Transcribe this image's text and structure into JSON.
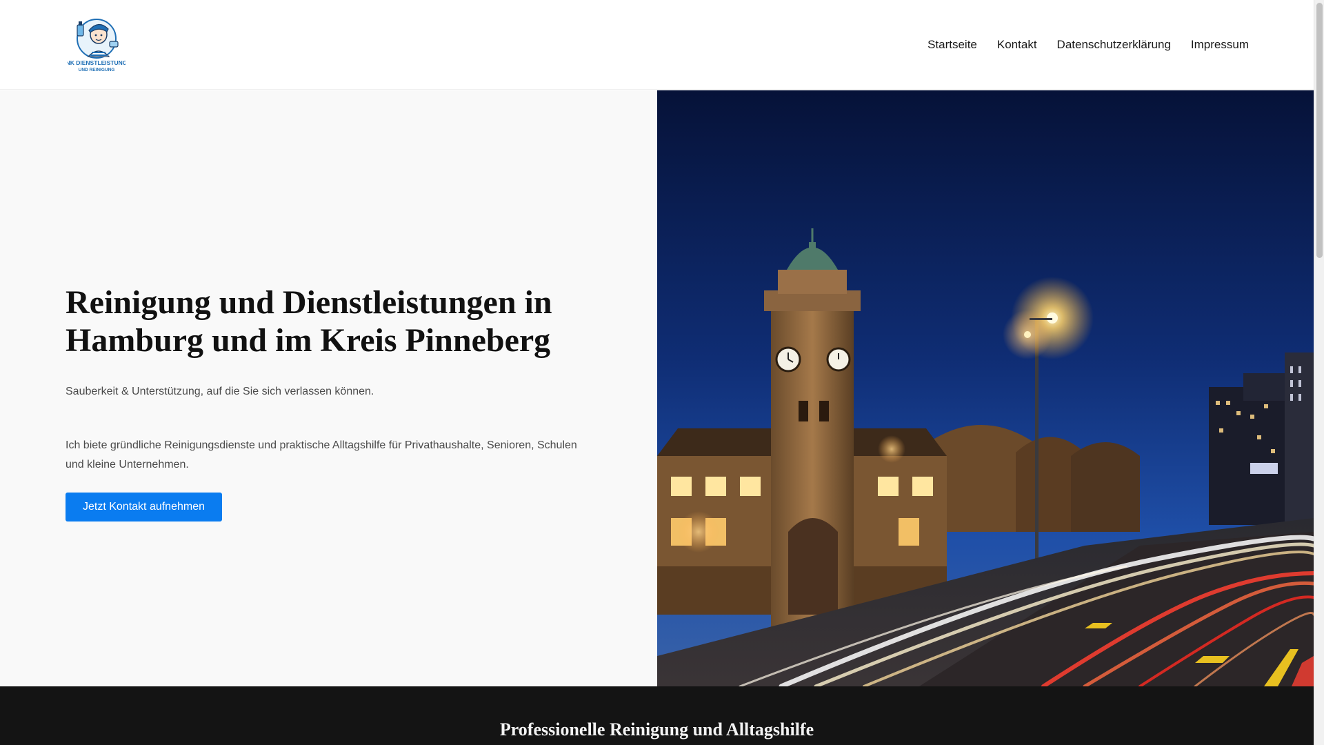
{
  "header": {
    "logo": {
      "icon": "cleaning-mascot-logo-icon",
      "line1": "NK DIENSTLEISTUNG",
      "line2": "UND REINIGUNG",
      "color": "#1f6fb5"
    },
    "nav": [
      {
        "label": "Startseite"
      },
      {
        "label": "Kontakt"
      },
      {
        "label": "Datenschutzerklärung"
      },
      {
        "label": "Impressum"
      }
    ]
  },
  "hero": {
    "title": "Reinigung und Dienstleistungen in Hamburg und im Kreis Pinneberg",
    "subtitle": "Sauberkeit & Unterstützung, auf die Sie sich verlassen können.",
    "description": "Ich biete gründliche Reinigungsdienste und praktische Alltagshilfe für Privathaushalte, Senioren, Schulen und kleine Unternehmen.",
    "cta_label": "Jetzt Kontakt aufnehmen",
    "accent": "#0a7cf0",
    "image": "hamburg-landungsbruecken-night-photo"
  },
  "section": {
    "title": "Professionelle Reinigung und Alltagshilfe"
  }
}
